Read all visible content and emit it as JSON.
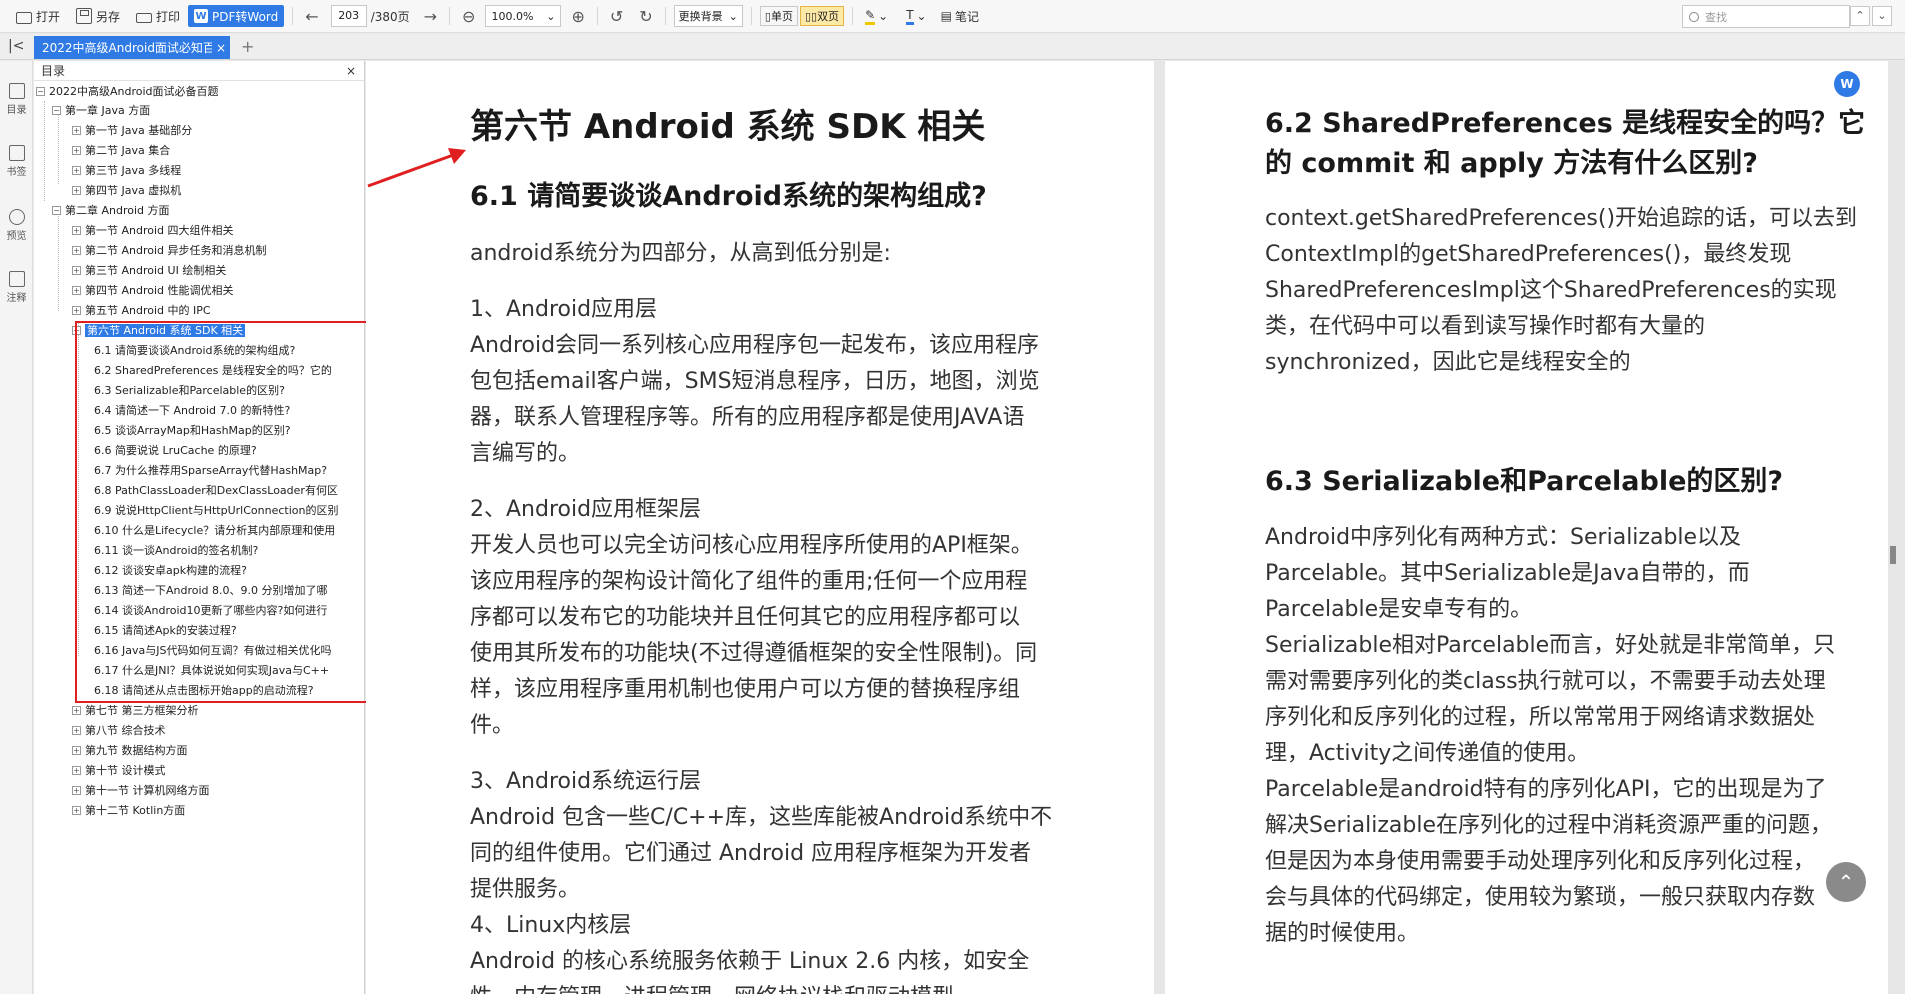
{
  "toolbar": {
    "open": "打开",
    "save_as": "另存",
    "print": "打印",
    "pdf_to_word": "PDF转Word",
    "current_page": "203",
    "total_pages": "/380页",
    "zoom": "100.0%",
    "background": "更换背景",
    "single_page": "单页",
    "double_page": "双页",
    "note": "笔记",
    "search_placeholder": "查找"
  },
  "tab": {
    "title": "2022中高级Android面试必知百题",
    "close": "×",
    "new": "+"
  },
  "rail": {
    "outline": "目录",
    "bookmark": "书签",
    "preview": "预览",
    "comment": "注释"
  },
  "outline": {
    "header": "目录",
    "close": "×",
    "root": "2022中高级Android面试必备百题",
    "ch1": "第一章 Java 方面",
    "ch1_items": [
      "第一节 Java 基础部分",
      "第二节 Java 集合",
      "第三节 Java 多线程",
      "第四节 Java 虚拟机"
    ],
    "ch2": "第二章 Android 方面",
    "ch2_items": [
      "第一节 Android 四大组件相关",
      "第二节 Android 异步任务和消息机制",
      "第三节 Android UI 绘制相关",
      "第四节 Android 性能调优相关",
      "第五节 Android 中的 IPC"
    ],
    "sec6": "第六节 Android 系统 SDK 相关",
    "sec6_items": [
      "6.1 请简要谈谈Android系统的架构组成?",
      "6.2 SharedPreferences 是线程安全的吗？它的",
      "6.3 Serializable和Parcelable的区别?",
      "6.4 请简述一下 Android 7.0 的新特性?",
      "6.5 谈谈ArrayMap和HashMap的区别?",
      "6.6 简要说说 LruCache 的原理?",
      "6.7 为什么推荐用SparseArray代替HashMap?",
      "6.8 PathClassLoader和DexClassLoader有何区",
      "6.9 说说HttpClient与HttpUrlConnection的区别",
      "6.10 什么是Lifecycle？请分析其内部原理和使用",
      "6.11 谈一谈Android的签名机制?",
      "6.12 谈谈安卓apk构建的流程?",
      "6.13 简述一下Android 8.0、9.0 分别增加了哪",
      "6.14 谈谈Android10更新了哪些内容?如何进行",
      "6.15 请简述Apk的安装过程?",
      "6.16 Java与JS代码如何互调？有做过相关优化吗",
      "6.17 什么是JNI？具体说说如何实现Java与C++",
      "6.18 请简述从点击图标开始app的启动流程?"
    ],
    "more_items": [
      "第七节 第三方框架分析",
      "第八节 综合技术",
      "第九节 数据结构方面",
      "第十节 设计模式",
      "第十一节 计算机网络方面",
      "第十二节 Kotlin方面"
    ]
  },
  "left_page": {
    "section_title": "第六节 Android 系统 SDK 相关",
    "q_title": "6.1 请简要谈谈Android系统的架构组成?",
    "lines": [
      "android系统分为四部分，从高到低分别是:",
      "1、Android应用层",
      "Android会同一系列核心应用程序包一起发布，该应用程序",
      "包包括email客户端，SMS短消息程序，日历，地图，浏览",
      "器，联系人管理程序等。所有的应用程序都是使用JAVA语",
      "言编写的。",
      "2、Android应用框架层",
      "开发人员也可以完全访问核心应用程序所使用的API框架。",
      "该应用程序的架构设计简化了组件的重用;任何一个应用程",
      "序都可以发布它的功能块并且任何其它的应用程序都可以",
      "使用其所发布的功能块(不过得遵循框架的安全性限制)。同",
      "样，该应用程序重用机制也使用户可以方便的替换程序组",
      "件。",
      "3、Android系统运行层",
      "Android 包含一些C/C++库，这些库能被Android系统中不",
      "同的组件使用。它们通过 Android 应用程序框架为开发者",
      "提供服务。",
      "4、Linux内核层",
      "Android 的核心系统服务依赖于 Linux 2.6 内核，如安全",
      "性，内存管理，进程管理，网络协议栈和驱动模型。"
    ]
  },
  "right_page": {
    "q62_line1": "6.2 SharedPreferences 是线程安全的吗？它",
    "q62_line2": "的 commit 和 apply 方法有什么区别?",
    "q62_lines": [
      "context.getSharedPreferences()开始追踪的话，可以去到",
      "ContextImpl的getSharedPreferences()，最终发现",
      "SharedPreferencesImpl这个SharedPreferences的实现",
      "类，在代码中可以看到读写操作时都有大量的",
      "synchronized，因此它是线程安全的"
    ],
    "q63_title": "6.3 Serializable和Parcelable的区别?",
    "q63_lines": [
      "Android中序列化有两种方式：Serializable以及",
      "Parcelable。其中Serializable是Java自带的，而",
      "Parcelable是安卓专有的。",
      "Serializable相对Parcelable而言，好处就是非常简单，只",
      "需对需要序列化的类class执行就可以，不需要手动去处理",
      "序列化和反序列化的过程，所以常常用于网络请求数据处",
      "理，Activity之间传递值的使用。",
      "Parcelable是android特有的序列化API，它的出现是为了",
      "解决Serializable在序列化的过程中消耗资源严重的问题，",
      "但是因为本身使用需要手动处理序列化和反序列化过程，",
      "会与具体的代码绑定，使用较为繁琐，一般只获取内存数",
      "据的时候使用。"
    ]
  },
  "badges": {
    "word_badge": "W",
    "up_arrow": "⌃"
  },
  "colors": {
    "accent": "#2f7ae5",
    "highlight_box": "#e02020",
    "arrow": "#e02020"
  }
}
